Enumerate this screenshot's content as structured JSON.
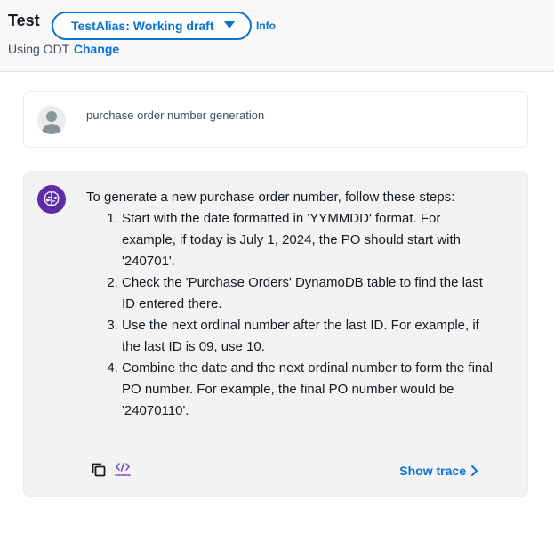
{
  "header": {
    "title": "Test",
    "alias_selector": "TestAlias: Working draft",
    "info_link": "Info",
    "using_prefix": "Using ODT",
    "change_link": "Change"
  },
  "conversation": {
    "user_message": "purchase order number generation",
    "agent_intro": "To generate a new purchase order number, follow these steps:",
    "agent_steps": [
      "Start with the date formatted in 'YYMMDD' format. For example, if today is July 1, 2024, the PO should start with '240701'.",
      "Check the 'Purchase Orders' DynamoDB table to find the last ID entered there.",
      "Use the next ordinal number after the last ID. For example, if the last ID is 09, use 10.",
      "Combine the date and the next ordinal number to form the final PO number. For example, the final PO number would be '24070110'."
    ],
    "show_trace_label": "Show trace"
  },
  "icons": {
    "caret": "caret-down-icon",
    "user_avatar": "user-avatar-icon",
    "agent_avatar": "agent-brain-icon",
    "copy": "copy-icon",
    "code": "code-icon",
    "chevron": "chevron-right-icon"
  },
  "colors": {
    "accent": "#0972d3",
    "agent_avatar_bg": "#5e2ca5",
    "agent_card_bg": "#f2f3f3",
    "header_bg": "#f8f8f8"
  }
}
